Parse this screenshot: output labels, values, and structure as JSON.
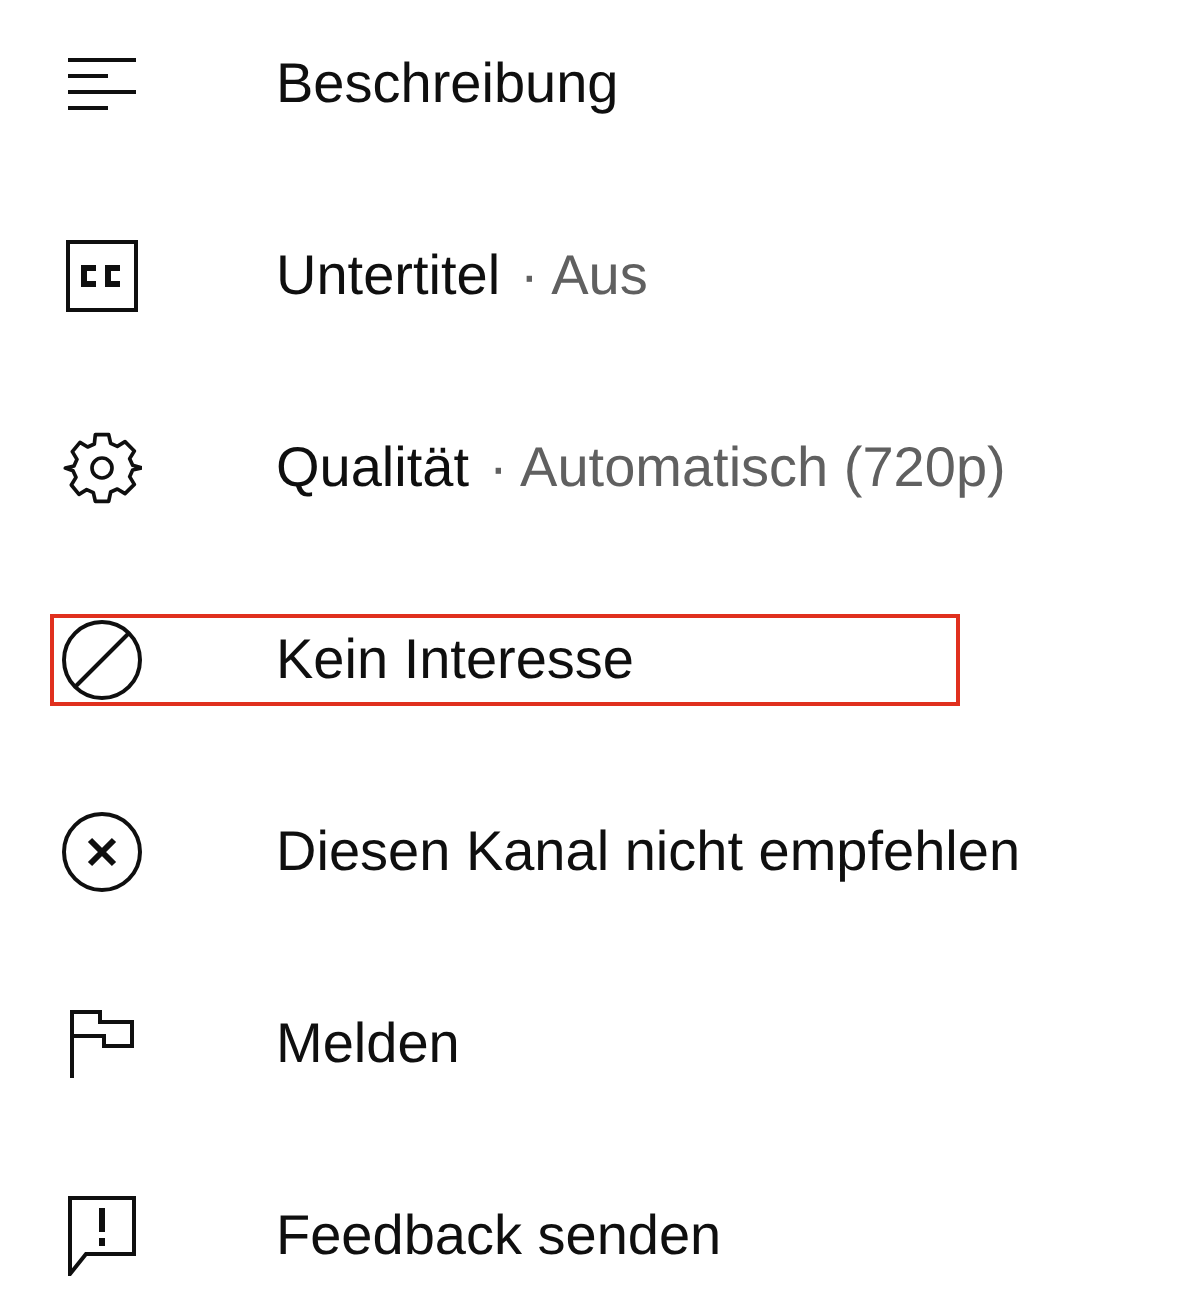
{
  "items": [
    {
      "label": "Beschreibung",
      "highlighted": false
    },
    {
      "label": "Untertitel",
      "value": "· Aus",
      "highlighted": false
    },
    {
      "label": "Qualität",
      "value": "· Automatisch (720p)",
      "highlighted": false
    },
    {
      "label": "Kein Interesse",
      "highlighted": true
    },
    {
      "label": "Diesen Kanal nicht empfehlen",
      "highlighted": false
    },
    {
      "label": "Melden",
      "highlighted": false
    },
    {
      "label": "Feedback senden",
      "highlighted": false
    }
  ]
}
